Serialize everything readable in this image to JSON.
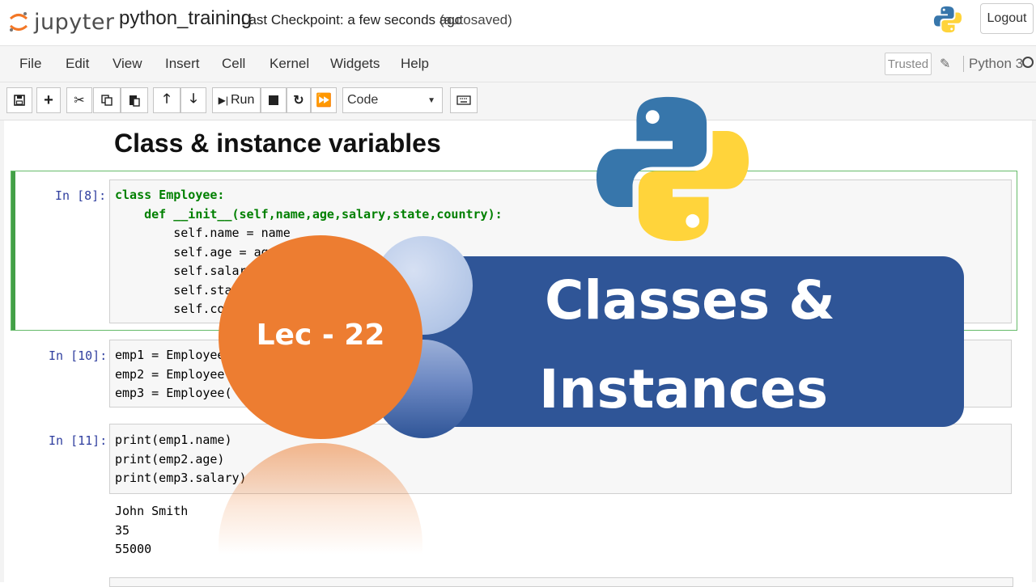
{
  "header": {
    "logo_text": "jupyter",
    "notebook_name": "python_training",
    "checkpoint": "Last Checkpoint: a few seconds ago",
    "autosave": "(autosaved)",
    "logout_label": "Logout"
  },
  "menu": {
    "items": [
      "File",
      "Edit",
      "View",
      "Insert",
      "Cell",
      "Kernel",
      "Widgets",
      "Help"
    ],
    "trusted_label": "Trusted",
    "kernel_name": "Python 3"
  },
  "toolbar": {
    "run_label": "Run",
    "cell_type": "Code"
  },
  "notebook": {
    "heading": "Class & instance variables",
    "cells": [
      {
        "prompt": "In [8]:",
        "lines": [
          "class Employee:",
          "    def __init__(self,name,age,salary,state,country):",
          "        self.name = name",
          "        self.age = age",
          "        self.salary = salary",
          "        self.state = state",
          "        self.country = country"
        ]
      },
      {
        "prompt": "In [10]:",
        "lines": [
          "emp1 = Employee(",
          "emp2 = Employee(",
          "emp3 = Employee('"
        ]
      },
      {
        "prompt": "In [11]:",
        "lines": [
          "print(emp1.name)",
          "print(emp2.age)",
          "print(emp3.salary)"
        ],
        "output": [
          "John Smith",
          "35",
          "55000"
        ]
      }
    ]
  },
  "overlay": {
    "lecture_label": "Lec - 22",
    "title_line1": "Classes &",
    "title_line2": "Instances"
  },
  "colors": {
    "banner_blue": "#2f5597",
    "orange": "#ed7d31",
    "light_blue": "#b4c7e7",
    "python_blue": "#3776ab",
    "python_yellow": "#ffd43b",
    "prompt_blue": "#303f9f",
    "selected_green": "#43a047"
  }
}
